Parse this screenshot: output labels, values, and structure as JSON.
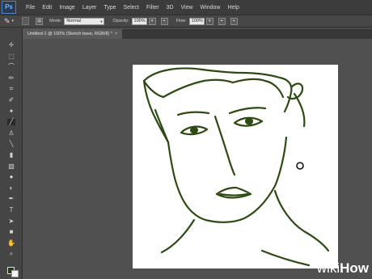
{
  "menubar": {
    "logo": "Ps",
    "items": [
      "File",
      "Edit",
      "Image",
      "Layer",
      "Type",
      "Select",
      "Filter",
      "3D",
      "View",
      "Window",
      "Help"
    ]
  },
  "options": {
    "mode_label": "Mode:",
    "mode_value": "Normal",
    "opacity_label": "Opacity:",
    "opacity_value": "100%",
    "flow_label": "Flow:",
    "flow_value": "100%"
  },
  "tab": {
    "label": "Untitled-1 @ 100% (Sketch base, RGB/8) *",
    "close": "×"
  },
  "colors": {
    "foreground": "#1f3d10",
    "background": "#f3f3f3",
    "stroke": "#2c4a12"
  },
  "watermark": {
    "wiki": "wiki",
    "how": "How"
  }
}
